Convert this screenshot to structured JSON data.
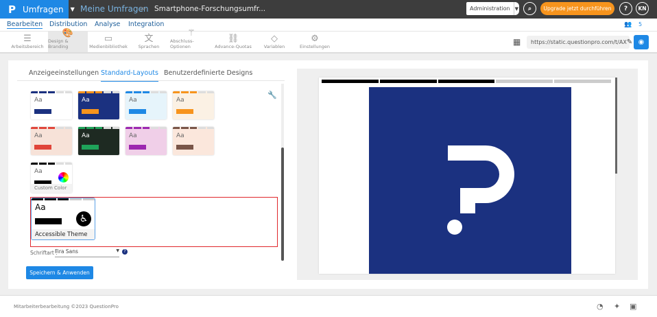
{
  "header": {
    "app": "Umfragen",
    "breadcrumb_root": "Meine Umfragen",
    "survey_title": "Smartphone-Forschungsumfr...",
    "admin": "Administration",
    "upgrade": "Upgrade jetzt durchführen",
    "help": "?",
    "avatar": "KN"
  },
  "nav": {
    "tabs": [
      "Bearbeiten",
      "Distribution",
      "Analyse",
      "Integration"
    ],
    "users_count": "5"
  },
  "toolbar": {
    "items": [
      "Arbeitsbereich",
      "Design & Branding",
      "Medienbibliothek",
      "Sprachen",
      "Abschluss-Optionen",
      "Advance-Quotas",
      "Variablen",
      "Einstellungen"
    ],
    "url": "https://static.questionpro.com/t/AX"
  },
  "design": {
    "tabs": [
      "Anzeigeeinstellungen",
      "Standard-Layouts",
      "Benutzerdefinierte Designs"
    ],
    "themes": [
      {
        "sample": "Aa",
        "bg": "#ffffff",
        "accent": "#1b3180",
        "text": "#666"
      },
      {
        "sample": "Aa",
        "bg": "#1b3180",
        "accent": "#f7941d",
        "text": "#fff"
      },
      {
        "sample": "Aa",
        "bg": "#e6f4fb",
        "accent": "#1e88e5",
        "text": "#666"
      },
      {
        "sample": "Aa",
        "bg": "#fbf1e4",
        "accent": "#f7941d",
        "text": "#666"
      },
      {
        "sample": "Aa",
        "bg": "#f7e2d8",
        "accent": "#e0453a",
        "text": "#666"
      },
      {
        "sample": "Aa",
        "bg": "#1e2a22",
        "accent": "#1fa35a",
        "text": "#fff"
      },
      {
        "sample": "Aa",
        "bg": "#f0cfe8",
        "accent": "#9c27b0",
        "text": "#666"
      },
      {
        "sample": "Aa",
        "bg": "#fbe7dc",
        "accent": "#795548",
        "text": "#666"
      },
      {
        "sample": "Aa",
        "bg": "#ffffff",
        "accent": "#000000",
        "text": "#666"
      }
    ],
    "custom_label": "Custom Color",
    "accessible_sample": "Aa",
    "accessible_label": "Accessible Theme",
    "font_label": "Schriftart :",
    "font_value": "Fira Sans",
    "save": "Speichern & Anwenden"
  },
  "footer": {
    "text": "Mitarbeiterbearbeitung ©2023 QuestionPro"
  }
}
